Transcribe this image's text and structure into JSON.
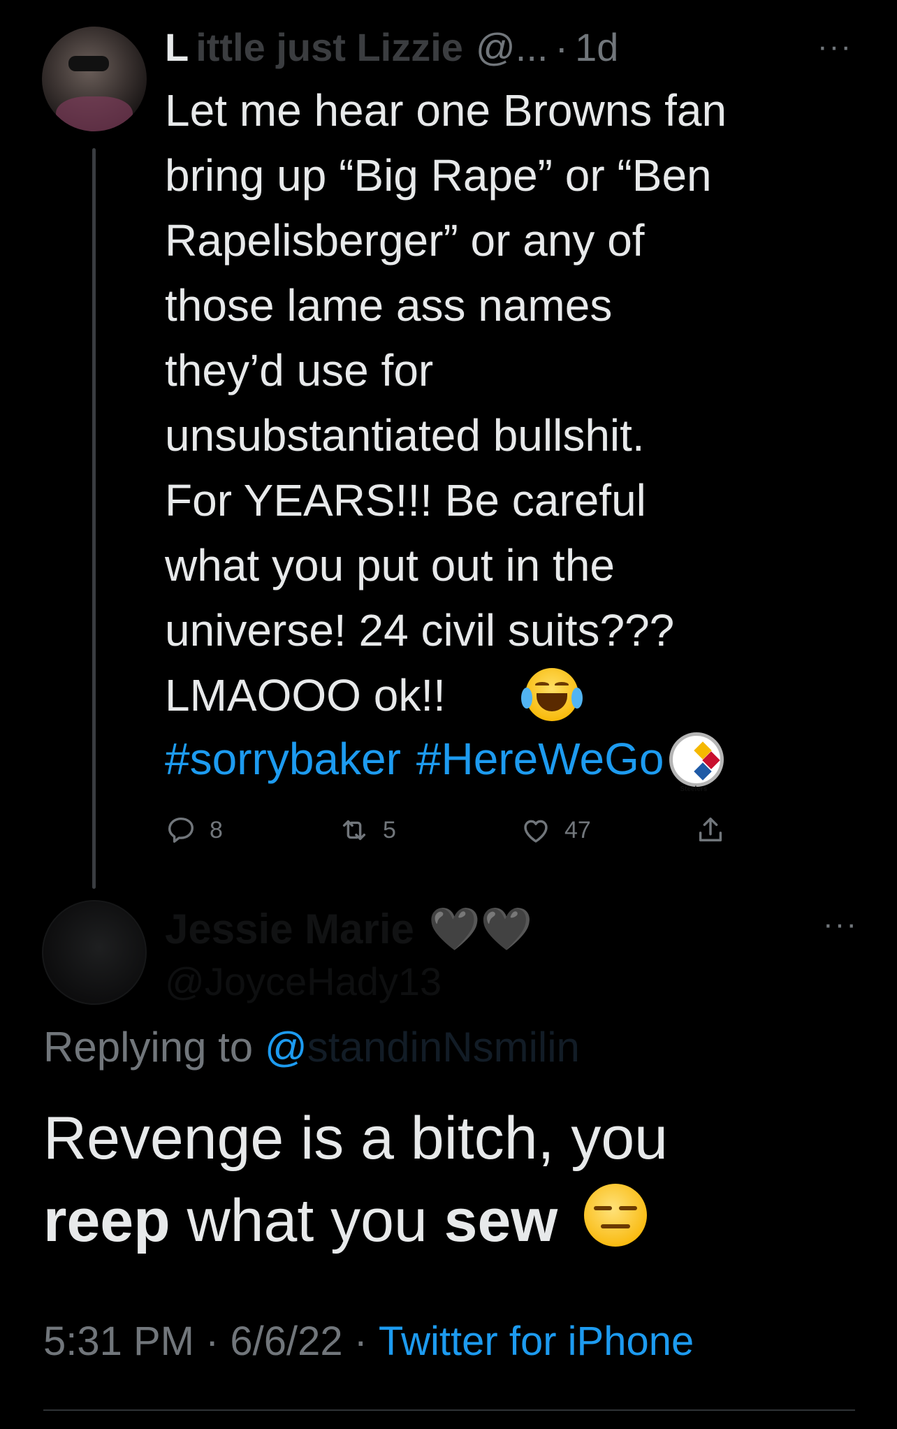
{
  "parent_tweet": {
    "author_initial": "L",
    "author_obscured": "ittle just Lizzie",
    "handle": "@...",
    "time_ago": "1d",
    "more": "···",
    "text": "Let me hear one Browns fan\nbring up “Big Rape” or “Ben\nRapelisberger” or any of\nthose lame ass names\nthey’d use for\nunsubstantiated bullshit.\nFor YEARS!!! Be careful\nwhat you put out in the\nuniverse! 24 civil suits???\nLMAOOO ok!!",
    "hashtags": [
      "#sorrybaker",
      "#HereWeGo"
    ],
    "emoji_laugh": "face-with-tears-of-joy-icon",
    "emoji_team": "steelers-logo-icon",
    "team_logo_text": "Steelers",
    "stats": {
      "replies": "8",
      "retweets": "5",
      "likes": "47"
    }
  },
  "reply_tweet": {
    "author_obscured": "Jessie Marie",
    "hearts": "🖤🖤",
    "handle_obscured": "@JoyceHady13",
    "more": "···",
    "replying_prefix": "Replying to",
    "replying_at": "@",
    "replying_handle_obscured": "standinNsmilin",
    "text_part1": "Revenge is a bitch, you",
    "text_bold1": "reep",
    "text_part2": " what you ",
    "text_bold2": "sew",
    "emoji": "expressionless-face-icon",
    "time": "5:31 PM",
    "date": "6/6/22",
    "source": "Twitter for iPhone"
  },
  "colors": {
    "background": "#000000",
    "text": "#e7e9ea",
    "muted": "#71767b",
    "accent": "#1d9bf0"
  }
}
